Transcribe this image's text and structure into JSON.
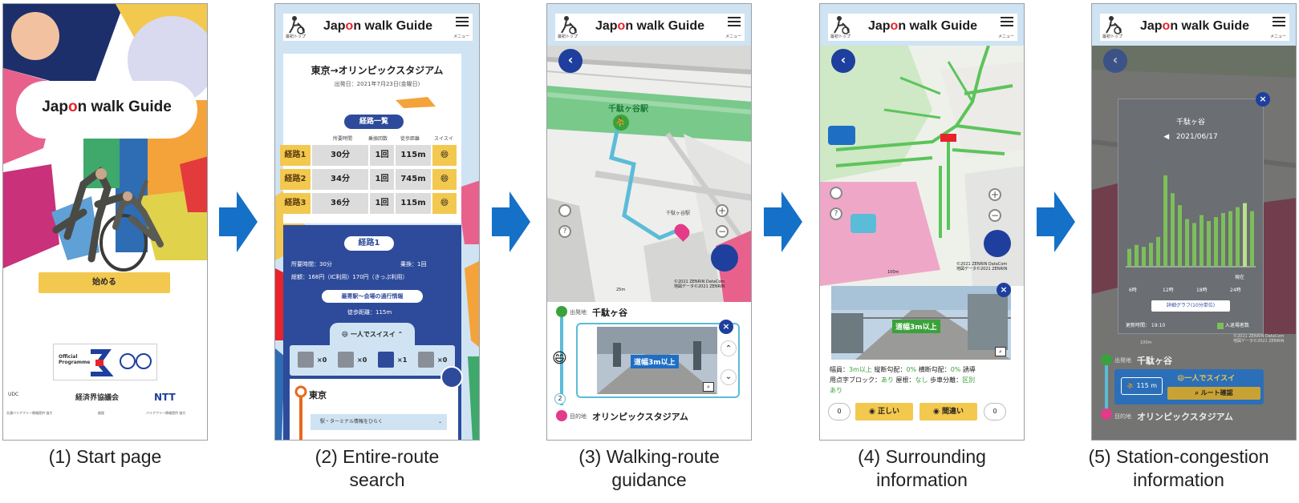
{
  "app": {
    "logo_pre": "Jap",
    "logo_o": "o",
    "logo_post": "n walk",
    "logo_guide": "Guide",
    "header_top_label": "最初トップ",
    "header_menu_label": "メニュー"
  },
  "captions": [
    {
      "line1": "(1) Start page",
      "line2": ""
    },
    {
      "line1": "(2) Entire-route",
      "line2": "search"
    },
    {
      "line1": "(3) Walking-route",
      "line2": "guidance"
    },
    {
      "line1": "(4) Surrounding",
      "line2": "information"
    },
    {
      "line1": "(5) Station-congestion",
      "line2": "information"
    }
  ],
  "screen1": {
    "start_button": "始める",
    "official_programme": "Official Programme",
    "supporter_left": "UDC",
    "supporter_keidanren": "経済界協議会",
    "supporter_ntt": "NTT",
    "footer_left": "交通バリアフリー情報提供 協力",
    "footer_mid": "後援",
    "footer_right": "バリアフリー情報提供 協力"
  },
  "screen2": {
    "title": "東京→オリンピックスタジアム",
    "date": "出発日：2021年7月23日(金曜日)",
    "route_list_label": "経路一覧",
    "col_time": "所要時間",
    "col_transfers": "乗換回数",
    "col_distance": "徒歩距離",
    "col_suisui": "スイスイ",
    "routes": [
      {
        "name": "経路1",
        "time": "30分",
        "transfers": "1回",
        "distance": "115m"
      },
      {
        "name": "経路2",
        "time": "34分",
        "transfers": "1回",
        "distance": "745m"
      },
      {
        "name": "経路3",
        "time": "36分",
        "transfers": "1回",
        "distance": "115m"
      }
    ],
    "detail_label": "経路1",
    "duration": "所要時間：30分",
    "transfer": "乗換：1回",
    "fare": "総額：168円（IC利用）170円（きっぷ利用）",
    "nearest_info": "最寄駅〜会場の通行情報",
    "walk_distance": "徒歩距離：115m",
    "suisui_label": "一人でスイスイ",
    "counts": [
      "×0",
      "×0",
      "×1",
      "×0"
    ],
    "origin": "東京",
    "terminal_info": "駅・ターミナル情報をひらく"
  },
  "screen3": {
    "station": "千駄ヶ谷駅",
    "station_small": "千駄ヶ谷駅",
    "scale": "25m",
    "copyright1": "©2021 ZENRIN DataCom",
    "copyright2": "地図データ©2021 ZENRIN",
    "origin_label": "出発地",
    "origin_name": "千駄ヶ谷",
    "dest_label": "目的地",
    "dest_name": "オリンピックスタジアム",
    "photo_caption": "道幅3m以上",
    "step_number": "2"
  },
  "screen4": {
    "scale": "100m",
    "copyright1": "©2021 ZENRIN DataCom",
    "copyright2": "地図データ©2021 ZENRIN",
    "photo_caption": "道幅3m以上",
    "width_label": "幅員：",
    "width_value": "3m以上",
    "slope_label": "縦断勾配：",
    "slope_value": "0%",
    "cross_label": "横断勾配：",
    "cross_value": "0%",
    "guide_label": "誘導",
    "braille_label": "用点字ブロック：",
    "braille_value": "あり",
    "roof_label": "屋根：",
    "roof_value": "なし",
    "sep_label": "歩車分離：",
    "sep_value": "区別",
    "sep_value2": "あり",
    "correct_label": "正しい",
    "wrong_label": "間違い",
    "correct_count": "0",
    "wrong_count": "0"
  },
  "screen5": {
    "station": "千駄ヶ谷",
    "date": "2021/06/17",
    "now_label": "現在",
    "ticks": [
      "6時",
      "12時",
      "18時",
      "24時"
    ],
    "detail_button": "詳細グラフ(10分単位)",
    "updated": "更新時間： 19:10",
    "legend": "入退場者数",
    "origin_label": "出発地",
    "origin_name": "千駄ヶ谷",
    "walk": "115 m",
    "suisui": "一人でスイスイ",
    "route_check": "ルート確認",
    "dest_label": "目的地",
    "dest_name": "オリンピックスタジアム",
    "copyright1": "©2021 ZENRIN DataCom",
    "copyright2": "地図データ©2021 ZENRIN",
    "scale": "100m",
    "bar_values": [
      0.18,
      0.22,
      0.2,
      0.24,
      0.3,
      0.92,
      0.74,
      0.62,
      0.48,
      0.44,
      0.52,
      0.46,
      0.5,
      0.54,
      0.56,
      0.6,
      0.64,
      0.56
    ],
    "highlight_index": 16
  },
  "colors": {
    "brand_blue": "#2e4b9b",
    "accent_yellow": "#f3c84e",
    "header_blue": "#cfe3f3",
    "route_green": "#5cc45a",
    "bar_green": "#7cbf5a",
    "arrow_blue": "#1570c8"
  },
  "icons": [
    "menu-icon",
    "back-icon",
    "close-icon",
    "location-icon",
    "help-icon",
    "zoom-in-icon",
    "zoom-out-icon",
    "walker-icon",
    "smile-icon",
    "chevron-up-icon",
    "chevron-down-icon",
    "search-icon"
  ]
}
